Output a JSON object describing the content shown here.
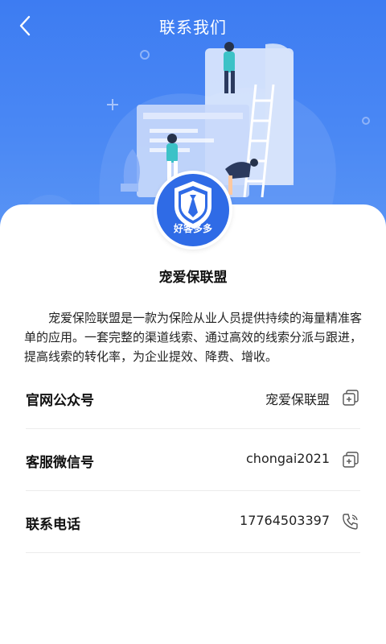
{
  "header": {
    "title": "联系我们",
    "back_icon": "chevron-left-icon"
  },
  "logo": {
    "text": "好客多多",
    "icon": "shield-tie-icon"
  },
  "brand": {
    "name": "宠爱保联盟"
  },
  "description": "宠爱保险联盟是一款为保险从业人员提供持续的海量精准客单的应用。一套完整的渠道线索、通过高效的线索分派与跟进，提高线索的转化率，为企业提效、降费、增收。",
  "contacts": [
    {
      "label": "官网公众号",
      "value": "宠爱保联盟",
      "action_icon": "copy-icon"
    },
    {
      "label": "客服微信号",
      "value": "chongai2021",
      "action_icon": "copy-icon"
    },
    {
      "label": "联系电话",
      "value": "17764503397",
      "action_icon": "phone-icon"
    }
  ],
  "colors": {
    "primary": "#3d7cf2",
    "logo": "#2f6be6"
  }
}
